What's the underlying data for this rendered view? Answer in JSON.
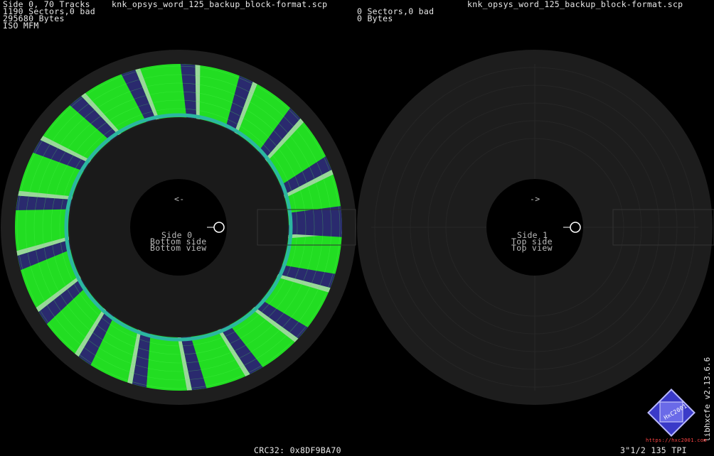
{
  "header": {
    "left_line1": "Side 0, 70 Tracks",
    "left_filename": "knk_opsys_word_125_backup_block-format.scp",
    "left_line2": "1190 Sectors,0 bad",
    "left_line3": "295680 Bytes",
    "left_line4": "ISO MFM",
    "right_line1": "0 Sectors,0 bad",
    "right_line2": "0 Bytes",
    "right_filename": "knk_opsys_word_125_backup_block-format.scp"
  },
  "disks": [
    {
      "arrow": "<-",
      "label_side": "Side 0",
      "label_pos": "Bottom side",
      "label_view": "Bottom view",
      "sectors_per_track": 17,
      "has_data": true
    },
    {
      "arrow": "->",
      "label_side": "Side 1",
      "label_pos": "Top side",
      "label_view": "Top view",
      "has_data": false
    }
  ],
  "colors": {
    "sector_ok": "#22dd22",
    "gap": "#2a2a6e",
    "sync": "#9ad79a",
    "disk_bg": "#1f1f1f",
    "hole": "#000000"
  },
  "footer": {
    "crc": "CRC32: 0x8DF9BA70",
    "drive": "3\"1/2 135 TPI",
    "version": "libhxcfe v2.13.6.6",
    "logo_text": "HxC2001",
    "url": "https://hxc2001.com"
  }
}
